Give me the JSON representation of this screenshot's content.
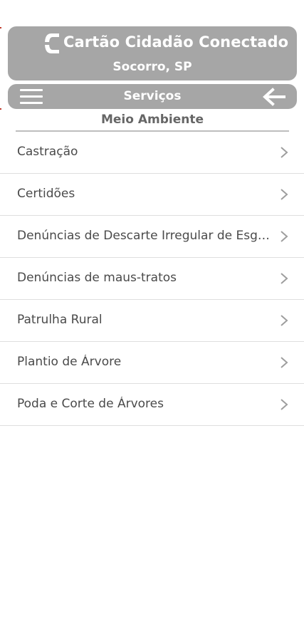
{
  "header": {
    "title": "Cartão Cidadão Conectado",
    "subtitle": "Socorro, SP",
    "logo_icon": "stylized-c-logo"
  },
  "nav": {
    "title": "Serviços",
    "menu_icon": "hamburger-menu-icon",
    "back_icon": "arrow-left-icon"
  },
  "section": {
    "title": "Meio Ambiente"
  },
  "services": [
    {
      "label": "Castração"
    },
    {
      "label": "Certidões"
    },
    {
      "label": "Denúncias de Descarte Irregular de Esgoto"
    },
    {
      "label": "Denúncias de maus-tratos"
    },
    {
      "label": "Patrulha Rural"
    },
    {
      "label": "Plantio de Árvore"
    },
    {
      "label": "Poda e Corte de Árvores"
    }
  ],
  "colors": {
    "header_bg": "#a6a6a6",
    "text": "#4a4a4a",
    "section_text": "#666666",
    "divider": "#dedede",
    "chevron": "#9e9e9e"
  }
}
